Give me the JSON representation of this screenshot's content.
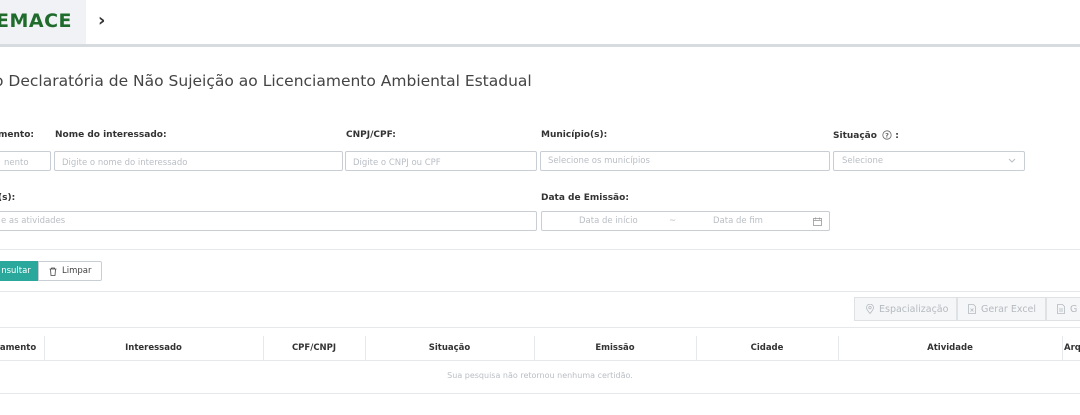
{
  "header": {
    "brand": "EMACE"
  },
  "page": {
    "title": "o Declaratória de Não Sujeição ao Licenciamento Ambiental Estadual"
  },
  "filters": {
    "row1": {
      "label_a": "mento:",
      "placeholder_a": "nento",
      "label_interessado": "Nome do interessado:",
      "placeholder_interessado": "Digite o nome do interessado",
      "label_cnpj": "CNPJ/CPF:",
      "placeholder_cnpj": "Digite o CNPJ ou CPF",
      "label_municipio": "Município(s):",
      "placeholder_municipio": "Selecione os municípios",
      "label_situacao": "Situação",
      "label_situacao_colon": ":",
      "placeholder_situacao": "Selecione"
    },
    "row2": {
      "label_atividades": "(s):",
      "placeholder_atividades": "e as atividades",
      "label_data": "Data de Emissão:",
      "placeholder_inicio": "Data de início",
      "range_sep": "~",
      "placeholder_fim": "Data de fim"
    }
  },
  "actions": {
    "consultar": "nsultar",
    "limpar": "Limpar"
  },
  "toolbar": {
    "espacializacao": "Espacialização",
    "gerar_excel": "Gerar Excel",
    "gerar_cut": "G"
  },
  "table": {
    "columns": [
      "amento",
      "Interessado",
      "CPF/CNPJ",
      "Situação",
      "Emissão",
      "Cidade",
      "Atividade",
      "Arqui"
    ],
    "empty_message": "Sua pesquisa não retornou nenhuma certidão."
  },
  "colors": {
    "brand_green": "#1f6b2c",
    "primary_teal": "#2aa89b"
  }
}
